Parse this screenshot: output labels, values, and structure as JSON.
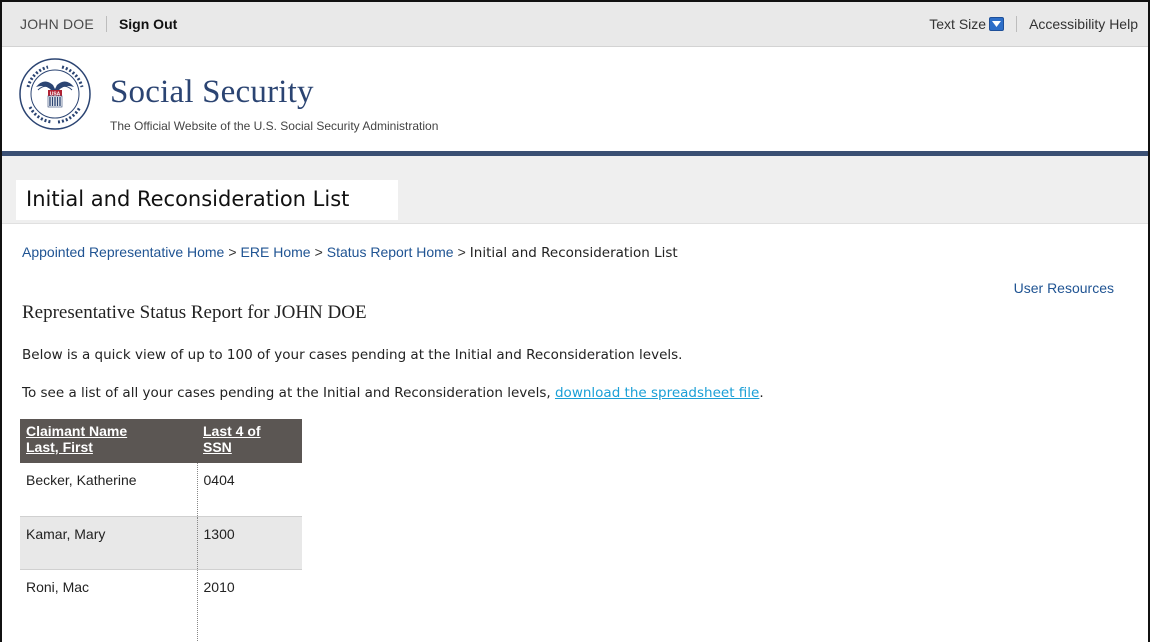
{
  "topbar": {
    "user_name": "JOHN DOE",
    "sign_out": "Sign Out",
    "text_size": "Text Size",
    "accessibility_help": "Accessibility Help"
  },
  "header": {
    "title": "Social Security",
    "subtitle": "The Official Website of the U.S. Social Security Administration",
    "seal_text": "SOCIAL SECURITY ADMINISTRATION USA"
  },
  "page": {
    "title": "Initial and Reconsideration List"
  },
  "breadcrumb": {
    "items": [
      "Appointed Representative Home",
      "ERE Home",
      "Status Report Home"
    ],
    "separator": ">",
    "current": "Initial and Reconsideration List"
  },
  "user_resources": "User Resources",
  "report": {
    "title": "Representative Status Report for JOHN DOE",
    "para1": "Below is a quick view of up to 100 of your cases pending at the Initial and Reconsideration levels.",
    "para2_prefix": "To see a list of all your cases pending at the Initial and Reconsideration levels, ",
    "para2_link": "download the spreadsheet file",
    "para2_suffix": "."
  },
  "table": {
    "headers": [
      {
        "line1": "Claimant Name",
        "line2": "Last, First"
      },
      {
        "line1": "Last 4 of",
        "line2": "SSN"
      }
    ],
    "rows": [
      {
        "name": "Becker, Katherine",
        "ssn": "0404"
      },
      {
        "name": "Kamar, Mary",
        "ssn": "1300"
      },
      {
        "name": "Roni, Mac",
        "ssn": "2010"
      }
    ]
  },
  "colors": {
    "navy": "#2b4472",
    "header_rule": "#3a4f73",
    "link": "#205493",
    "download_link": "#1a9fd6",
    "table_header": "#5b5653"
  }
}
